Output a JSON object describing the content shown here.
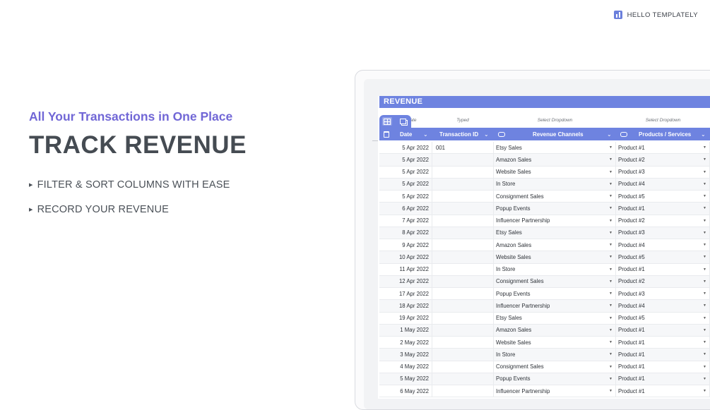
{
  "brand": {
    "name": "HELLO TEMPLATELY",
    "logo_icon": "bar-chart-icon",
    "color": "#6b7fdc"
  },
  "hero": {
    "subtitle": "All Your Transactions in One Place",
    "title": "TRACK REVENUE",
    "bullets": [
      "FILTER & SORT COLUMNS WITH EASE",
      "RECORD YOUR REVENUE"
    ]
  },
  "sheet": {
    "title": "REVENUE",
    "accent": "#6e83e0",
    "type_labels": {
      "date": "ate",
      "id": "Typed",
      "channels": "Select Dropdown",
      "products": "Select Dropdown"
    },
    "columns": [
      "Date",
      "Transaction ID",
      "Revenue Channels",
      "Products / Services"
    ],
    "rows": [
      {
        "date": "5 Apr 2022",
        "id": "001",
        "channel": "Etsy Sales",
        "product": "Product #1"
      },
      {
        "date": "5 Apr 2022",
        "id": "",
        "channel": "Amazon Sales",
        "product": "Product #2"
      },
      {
        "date": "5 Apr 2022",
        "id": "",
        "channel": "Website Sales",
        "product": "Product #3"
      },
      {
        "date": "5 Apr 2022",
        "id": "",
        "channel": "In Store",
        "product": "Product #4"
      },
      {
        "date": "5 Apr 2022",
        "id": "",
        "channel": "Consignment Sales",
        "product": "Product #5"
      },
      {
        "date": "6 Apr 2022",
        "id": "",
        "channel": "Popup Events",
        "product": "Product #1"
      },
      {
        "date": "7 Apr 2022",
        "id": "",
        "channel": "Influencer Partnership",
        "product": "Product #2"
      },
      {
        "date": "8 Apr 2022",
        "id": "",
        "channel": "Etsy Sales",
        "product": "Product #3"
      },
      {
        "date": "9 Apr 2022",
        "id": "",
        "channel": "Amazon Sales",
        "product": "Product #4"
      },
      {
        "date": "10 Apr 2022",
        "id": "",
        "channel": "Website Sales",
        "product": "Product #5"
      },
      {
        "date": "11 Apr 2022",
        "id": "",
        "channel": "In Store",
        "product": "Product #1"
      },
      {
        "date": "12 Apr 2022",
        "id": "",
        "channel": "Consignment Sales",
        "product": "Product #2"
      },
      {
        "date": "17 Apr 2022",
        "id": "",
        "channel": "Popup Events",
        "product": "Product #3"
      },
      {
        "date": "18 Apr 2022",
        "id": "",
        "channel": "Influencer Partnership",
        "product": "Product #4"
      },
      {
        "date": "19 Apr 2022",
        "id": "",
        "channel": "Etsy Sales",
        "product": "Product #5"
      },
      {
        "date": "1 May 2022",
        "id": "",
        "channel": "Amazon Sales",
        "product": "Product #1"
      },
      {
        "date": "2 May 2022",
        "id": "",
        "channel": "Website Sales",
        "product": "Product #1"
      },
      {
        "date": "3 May 2022",
        "id": "",
        "channel": "In Store",
        "product": "Product #1"
      },
      {
        "date": "4 May 2022",
        "id": "",
        "channel": "Consignment Sales",
        "product": "Product #1"
      },
      {
        "date": "5 May 2022",
        "id": "",
        "channel": "Popup Events",
        "product": "Product #1"
      },
      {
        "date": "6 May 2022",
        "id": "",
        "channel": "Influencer Partnership",
        "product": "Product #1"
      }
    ]
  }
}
